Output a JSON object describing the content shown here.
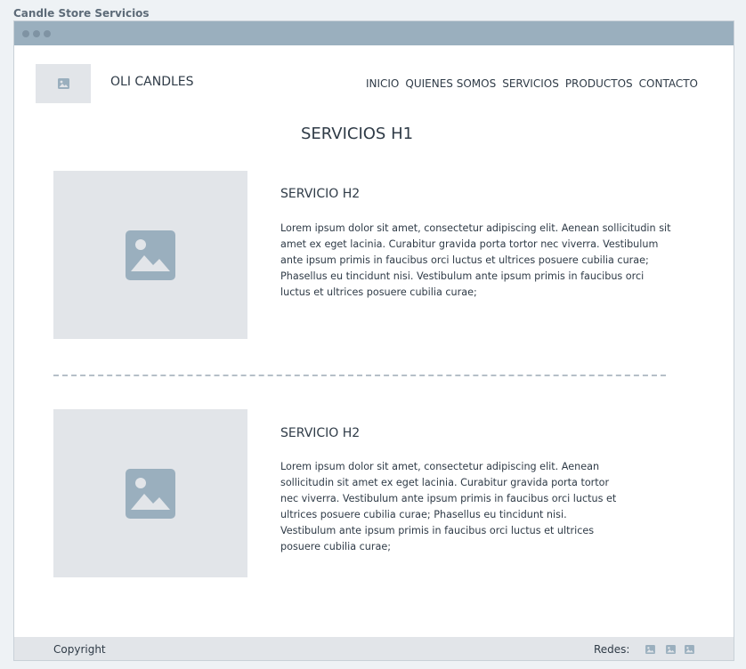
{
  "app": {
    "title": "Candle Store Servicios"
  },
  "header": {
    "brand": "OLI CANDLES",
    "nav": [
      "INICIO",
      "QUIENES SOMOS",
      "SERVICIOS",
      "PRODUCTOS",
      "CONTACTO"
    ]
  },
  "main": {
    "title": "SERVICIOS H1",
    "services": [
      {
        "heading": "SERVICIO  H2",
        "text": "Lorem ipsum dolor sit amet, consectetur adipiscing elit. Aenean sollicitudin sit amet ex eget lacinia. Curabitur gravida porta tortor nec viverra. Vestibulum ante ipsum primis in faucibus orci luctus et ultrices posuere cubilia curae; Phasellus eu tincidunt nisi. Vestibulum ante ipsum primis in faucibus orci luctus et ultrices posuere cubilia curae;"
      },
      {
        "heading": "SERVICIO  H2",
        "text": "Lorem ipsum dolor sit amet, consectetur adipiscing elit. Aenean sollicitudin sit amet ex eget lacinia. Curabitur gravida porta tortor nec viverra. Vestibulum ante ipsum primis in faucibus orci luctus et ultrices posuere cubilia curae; Phasellus eu tincidunt nisi. Vestibulum ante ipsum primis in faucibus orci luctus et ultrices posuere cubilia curae;"
      }
    ]
  },
  "footer": {
    "copyright": "Copyright",
    "redes_label": "Redes:"
  },
  "colors": {
    "placeholder_bg": "#e2e5e9",
    "placeholder_icon": "#9aafbe",
    "titlebar": "#9aafbe"
  },
  "icons": [
    "image-placeholder-icon"
  ]
}
